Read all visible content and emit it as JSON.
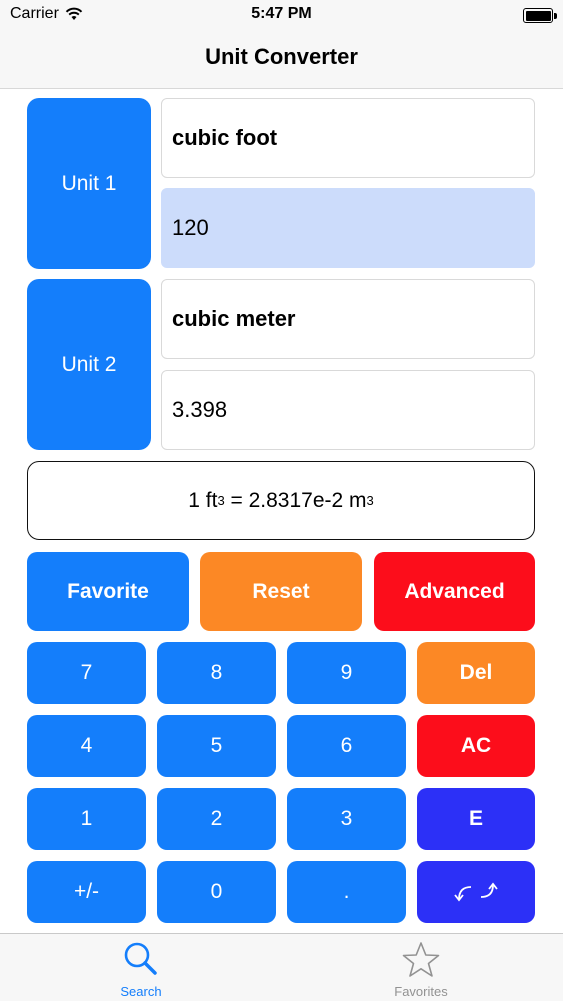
{
  "status_bar": {
    "carrier": "Carrier",
    "time": "5:47 PM"
  },
  "nav": {
    "title": "Unit Converter"
  },
  "unit1": {
    "label": "Unit 1",
    "name": "cubic foot",
    "value": "120"
  },
  "unit2": {
    "label": "Unit 2",
    "name": "cubic meter",
    "value": "3.398"
  },
  "formula": {
    "lhs": "1 ft",
    "lhs_sup": "3",
    "mid": " = 2.8317e-2 m",
    "rhs_sup": "3"
  },
  "actions": {
    "favorite": "Favorite",
    "reset": "Reset",
    "advanced": "Advanced"
  },
  "keypad": {
    "k7": "7",
    "k8": "8",
    "k9": "9",
    "del": "Del",
    "k4": "4",
    "k5": "5",
    "k6": "6",
    "ac": "AC",
    "k1": "1",
    "k2": "2",
    "k3": "3",
    "exp": "E",
    "sign": "+/-",
    "k0": "0",
    "dot": "."
  },
  "tabs": [
    {
      "label": "Search",
      "icon": "search-icon",
      "color": "#147efb",
      "selected": true
    },
    {
      "label": "Favorites",
      "icon": "star-icon",
      "color": "#929292",
      "selected": false
    }
  ],
  "colors": {
    "blue": "#147efb",
    "orange": "#fc8825",
    "red": "#fc0d1b",
    "indigo": "#2c30f7",
    "selected_field": "#ccdcfb"
  }
}
